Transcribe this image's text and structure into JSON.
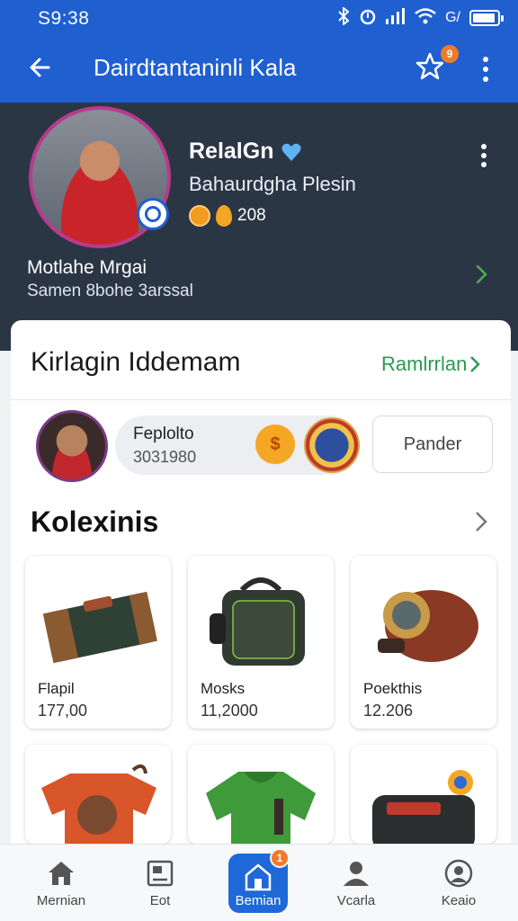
{
  "status_bar": {
    "time": "S9:38",
    "signal_label": "G/",
    "icons": [
      "bluetooth-icon",
      "alarm-icon",
      "signal-icon",
      "wifi-icon",
      "battery-icon"
    ]
  },
  "app_bar": {
    "title": "Dairdtantaninli Kala",
    "star_badge": "9",
    "accent": "#1f5fd0"
  },
  "profile": {
    "name": "RelalGn",
    "subtitle": "Bahaurdgha Plesin",
    "stats": "208",
    "location_title": "Motlahe Mrgai",
    "location_sub": "Samen 8bohe 3arssal"
  },
  "kirlagin": {
    "title": "Kirlagin Iddemam",
    "link": "Ramlrrlan",
    "item_name": "Feplolto",
    "item_number": "3031980",
    "coin_symbol": "$",
    "action_button": "Pander"
  },
  "koleksi": {
    "title": "Kolexinis",
    "items": [
      {
        "name": "Flapil",
        "price": "177,00"
      },
      {
        "name": "Mosks",
        "price": "11,2000"
      },
      {
        "name": "Poekthis",
        "price": "12.206"
      }
    ]
  },
  "bottom_nav": {
    "items": [
      {
        "label": "Mernian",
        "icon": "home-icon"
      },
      {
        "label": "Eot",
        "icon": "image-icon"
      },
      {
        "label": "Bemian",
        "icon": "shop-icon",
        "badge": "1"
      },
      {
        "label": "Vcarla",
        "icon": "user-icon"
      },
      {
        "label": "Keaio",
        "icon": "chat-icon"
      }
    ]
  },
  "colors": {
    "primary": "#1f5fd0",
    "header_dark": "#2b3645",
    "link_green": "#2a9a52",
    "badge_orange": "#f07a2a"
  }
}
